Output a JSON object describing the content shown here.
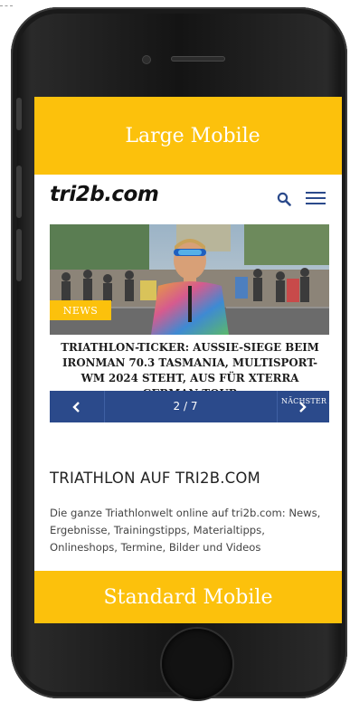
{
  "labels": {
    "top": "Large Mobile",
    "bottom": "Standard Mobile"
  },
  "site": {
    "logo": "tri2b.com",
    "search_icon": "search-icon",
    "menu_icon": "hamburger-menu-icon"
  },
  "article": {
    "badge": "NEWS",
    "headline": "TRIATHLON-TICKER: AUSSIE-SIEGE BEIM IRONMAN 70.3 TASMANIA, MULTISPORT-WM 2024 STEHT, AUS FÜR XTERRA GERMAN TOUR"
  },
  "slider": {
    "counter": "2 / 7",
    "next_label": "NÄCHSTER ARTIKEL",
    "prev_icon": "chevron-left-icon",
    "next_icon": "chevron-right-icon"
  },
  "section": {
    "title": "TRIATHLON AUF TRI2B.COM",
    "text": "Die ganze Triathlonwelt online auf tri2b.com: News, Ergebnisse, Trainingstipps, Materialtipps, Onlineshops, Termine, Bilder und Videos"
  },
  "colors": {
    "accent": "#fcc10c",
    "slider_bg": "#2b4a8b"
  }
}
